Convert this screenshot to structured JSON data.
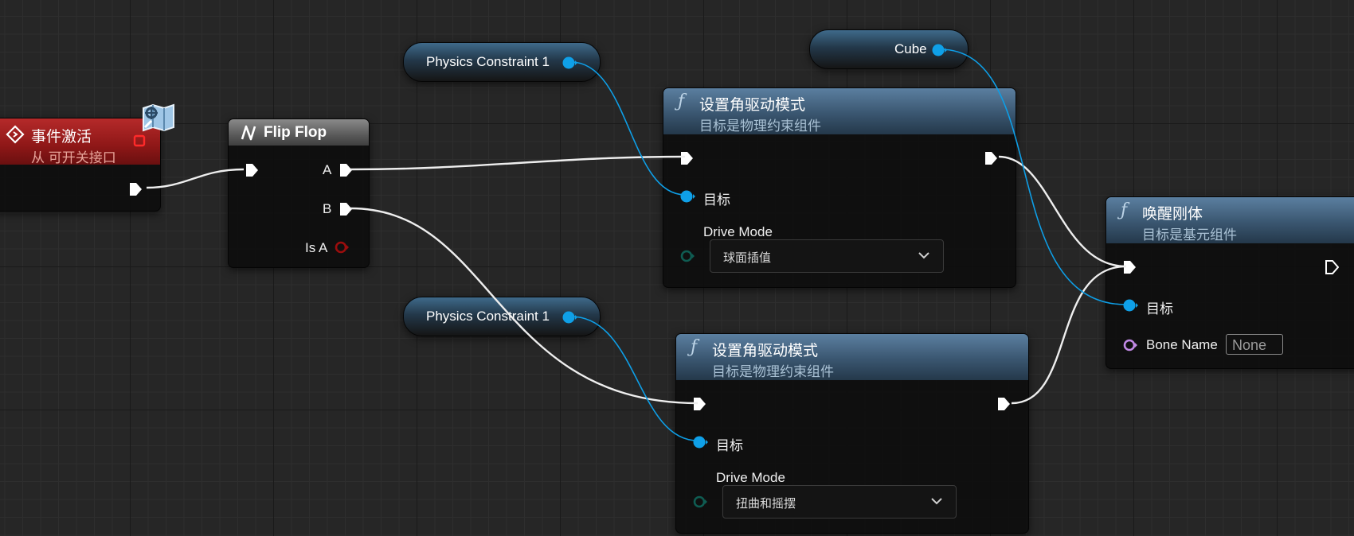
{
  "event_node": {
    "title": "事件激活",
    "subtitle": "从 可开关接口",
    "icon": "event-diamond-icon",
    "header_color": "#a51f1f"
  },
  "flipflop_node": {
    "title": "Flip Flop",
    "icon": "flipflop-icon",
    "pin_a": "A",
    "pin_b": "B",
    "pin_is_a": "Is A"
  },
  "getter_top": {
    "label": "Physics Constraint 1"
  },
  "getter_bottom": {
    "label": "Physics Constraint 1"
  },
  "getter_cube": {
    "label": "Cube"
  },
  "set_drive_top": {
    "title": "设置角驱动模式",
    "subtitle": "目标是物理约束组件",
    "target_label": "目标",
    "drive_mode_label": "Drive Mode",
    "drive_mode_value": "球面插值"
  },
  "set_drive_bottom": {
    "title": "设置角驱动模式",
    "subtitle": "目标是物理约束组件",
    "target_label": "目标",
    "drive_mode_label": "Drive Mode",
    "drive_mode_value": "扭曲和摇摆"
  },
  "wake_node": {
    "title": "唤醒刚体",
    "subtitle": "目标是基元组件",
    "target_label": "目标",
    "bone_name_label": "Bone Name",
    "bone_name_value": "None"
  },
  "colors": {
    "object_pin": "#0fa0e8",
    "exec_pin": "#ffffff",
    "bool_pin": "#8b0000",
    "name_pin": "#c28ae6",
    "enum_pin": "#0f5c52",
    "function_header": "#3d5a76",
    "event_header": "#a51f1f",
    "macro_header": "#6a6a6a",
    "subtitle_blue": "#a9c1d4",
    "subtitle_red": "#e7a49a"
  }
}
